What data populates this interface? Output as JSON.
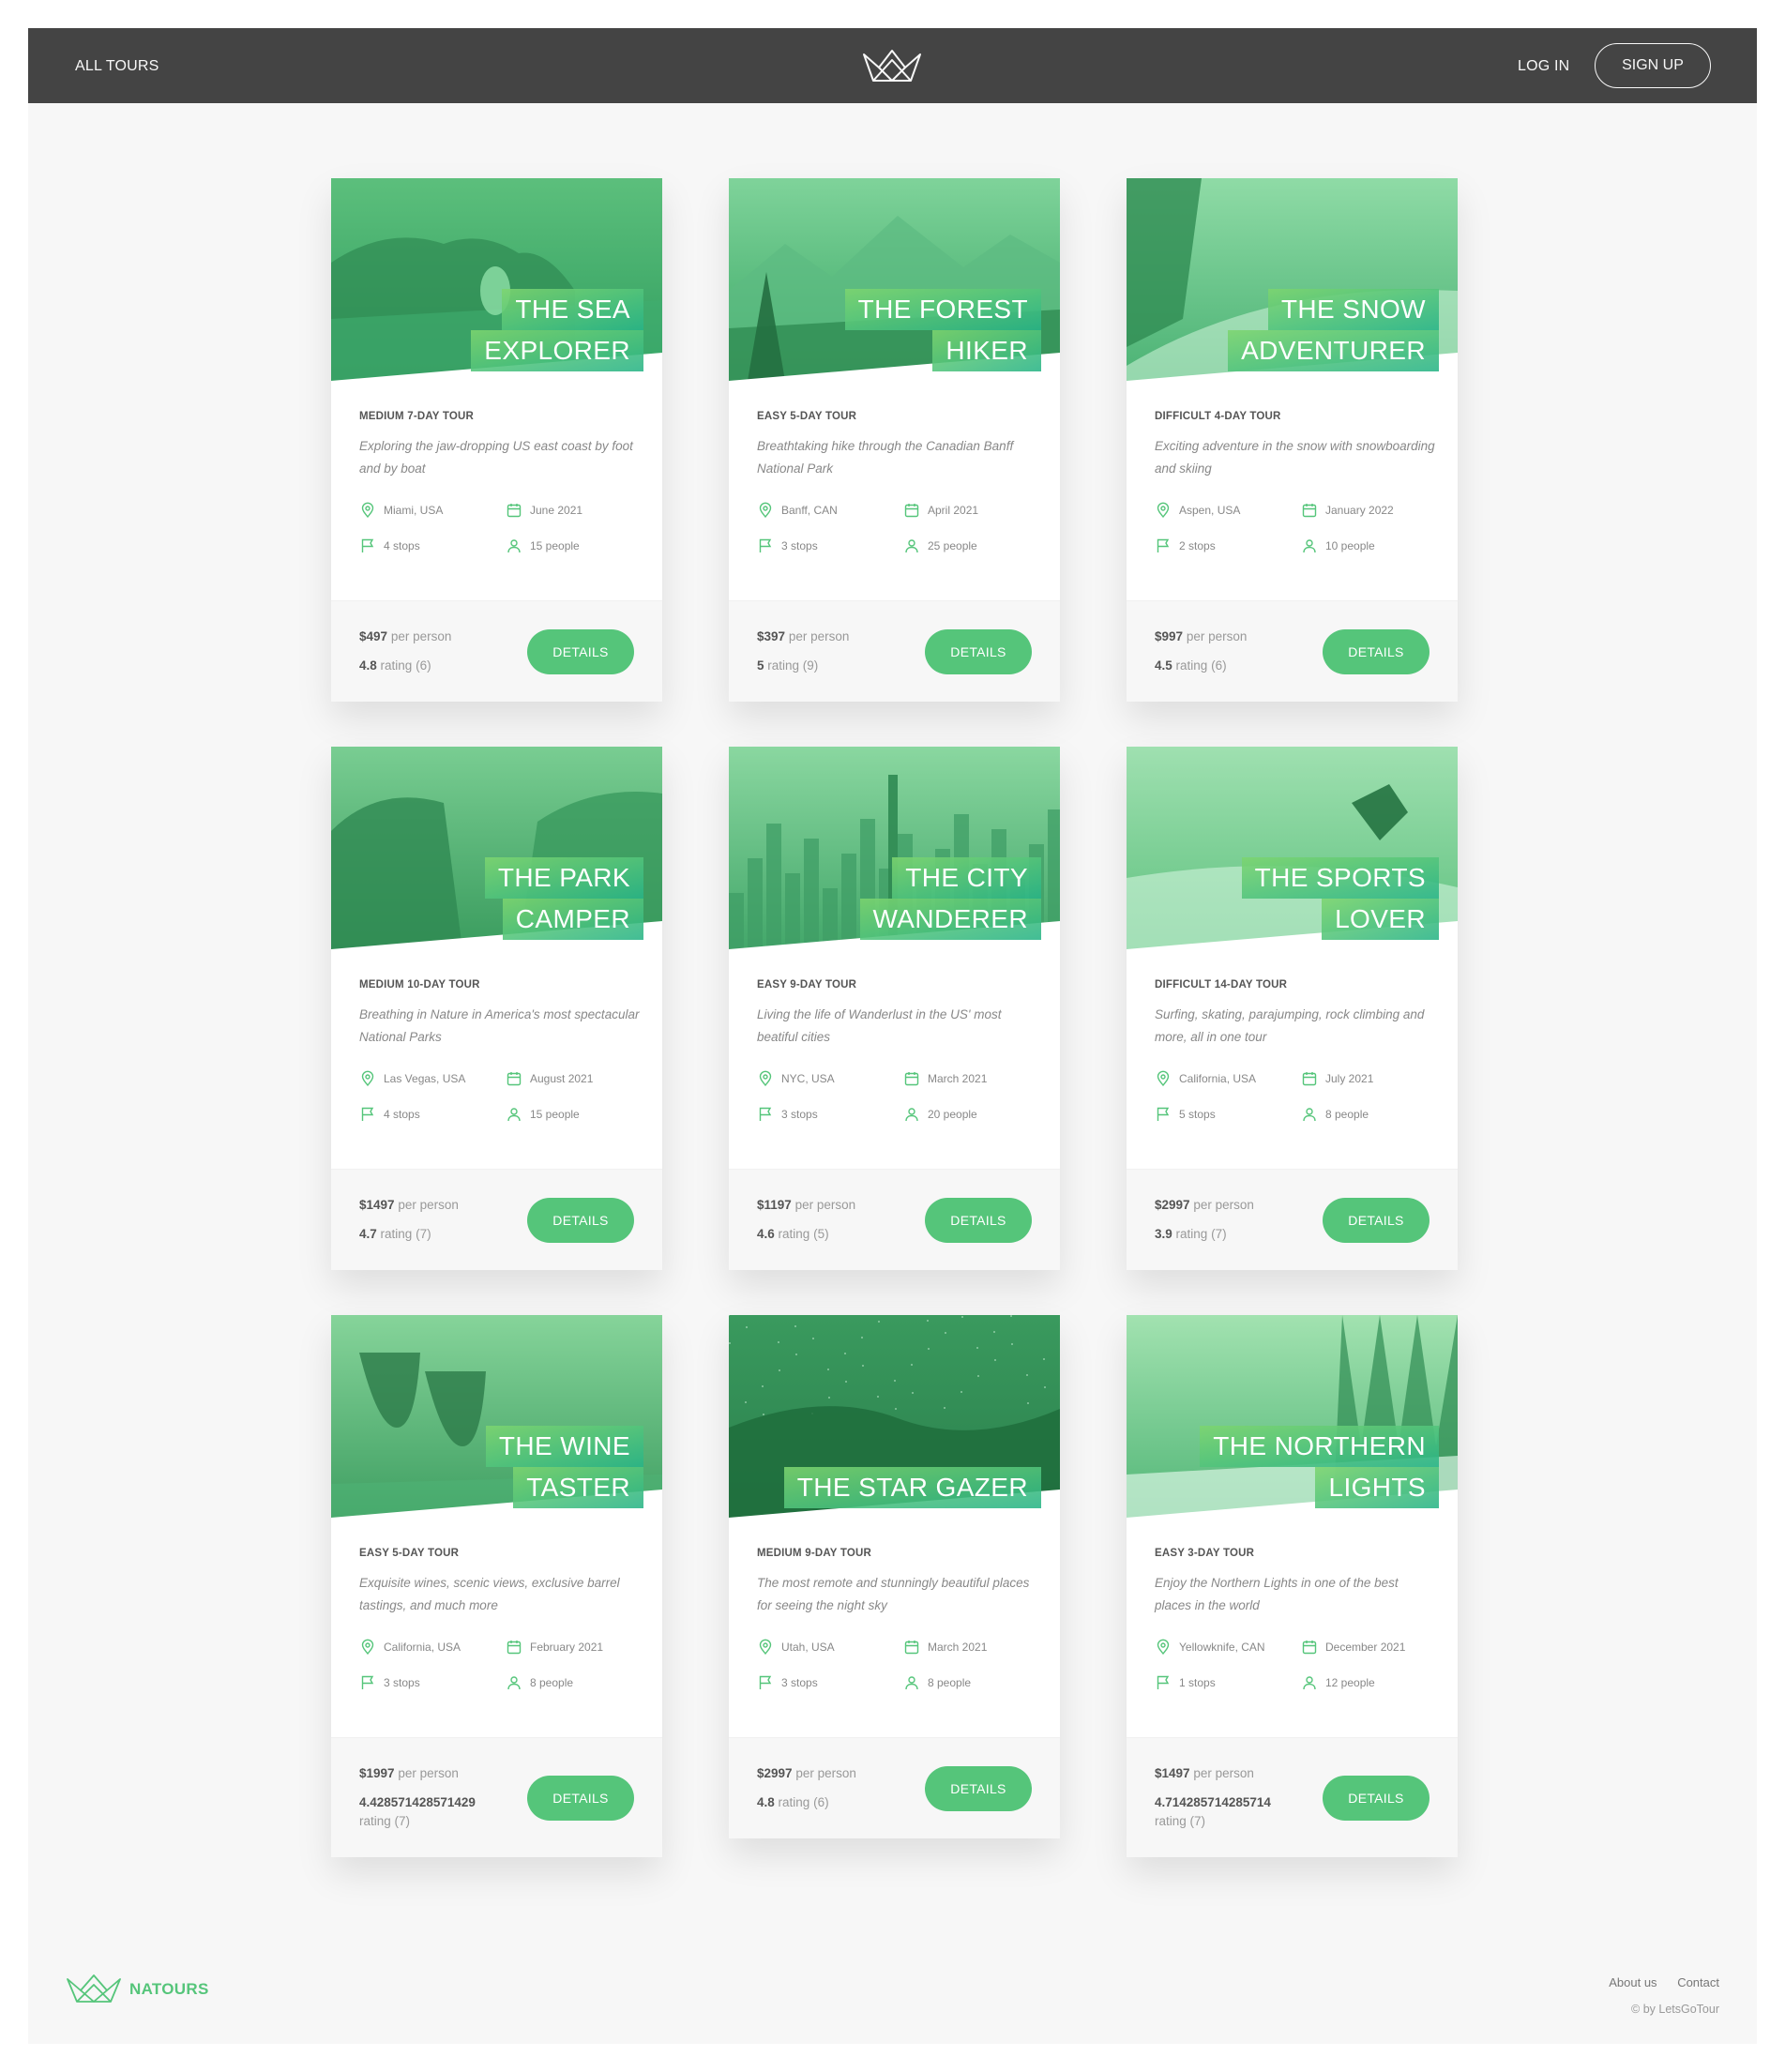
{
  "header": {
    "all_tours": "ALL TOURS",
    "log_in": "LOG IN",
    "sign_up": "SIGN UP",
    "logo_icon": "crown-logo-icon"
  },
  "colors": {
    "primary": "#55c57a",
    "header_bg": "#444444",
    "page_bg": "#f7f7f7"
  },
  "tours": [
    {
      "title_lines": [
        "THE SEA",
        "EXPLORER"
      ],
      "subheading": "MEDIUM 7-DAY TOUR",
      "summary": "Exploring the jaw-dropping US east coast by foot and by boat",
      "location": "Miami, USA",
      "date": "June 2021",
      "stops": "4 stops",
      "people": "15 people",
      "price": "$497",
      "price_suffix": "per person",
      "rating_value": "4.8",
      "rating_suffix": "rating (6)",
      "details": "DETAILS",
      "scene": "sea"
    },
    {
      "title_lines": [
        "THE FOREST",
        "HIKER"
      ],
      "subheading": "EASY 5-DAY TOUR",
      "summary": "Breathtaking hike through the Canadian Banff National Park",
      "location": "Banff, CAN",
      "date": "April 2021",
      "stops": "3 stops",
      "people": "25 people",
      "price": "$397",
      "price_suffix": "per person",
      "rating_value": "5",
      "rating_suffix": "rating (9)",
      "details": "DETAILS",
      "scene": "forest"
    },
    {
      "title_lines": [
        "THE SNOW",
        "ADVENTURER"
      ],
      "subheading": "DIFFICULT 4-DAY TOUR",
      "summary": "Exciting adventure in the snow with snowboarding and skiing",
      "location": "Aspen, USA",
      "date": "January 2022",
      "stops": "2 stops",
      "people": "10 people",
      "price": "$997",
      "price_suffix": "per person",
      "rating_value": "4.5",
      "rating_suffix": "rating (6)",
      "details": "DETAILS",
      "scene": "snow"
    },
    {
      "title_lines": [
        "THE PARK",
        "CAMPER"
      ],
      "subheading": "MEDIUM 10-DAY TOUR",
      "summary": "Breathing in Nature in America's most spectacular National Parks",
      "location": "Las Vegas, USA",
      "date": "August 2021",
      "stops": "4 stops",
      "people": "15 people",
      "price": "$1497",
      "price_suffix": "per person",
      "rating_value": "4.7",
      "rating_suffix": "rating (7)",
      "details": "DETAILS",
      "scene": "park"
    },
    {
      "title_lines": [
        "THE CITY",
        "WANDERER"
      ],
      "subheading": "EASY 9-DAY TOUR",
      "summary": "Living the life of Wanderlust in the US' most beatiful cities",
      "location": "NYC, USA",
      "date": "March 2021",
      "stops": "3 stops",
      "people": "20 people",
      "price": "$1197",
      "price_suffix": "per person",
      "rating_value": "4.6",
      "rating_suffix": "rating (5)",
      "details": "DETAILS",
      "scene": "city"
    },
    {
      "title_lines": [
        "THE SPORTS",
        "LOVER"
      ],
      "subheading": "DIFFICULT 14-DAY TOUR",
      "summary": "Surfing, skating, parajumping, rock climbing and more, all in one tour",
      "location": "California, USA",
      "date": "July 2021",
      "stops": "5 stops",
      "people": "8 people",
      "price": "$2997",
      "price_suffix": "per person",
      "rating_value": "3.9",
      "rating_suffix": "rating (7)",
      "details": "DETAILS",
      "scene": "sports"
    },
    {
      "title_lines": [
        "THE WINE",
        "TASTER"
      ],
      "subheading": "EASY 5-DAY TOUR",
      "summary": "Exquisite wines, scenic views, exclusive barrel tastings, and much more",
      "location": "California, USA",
      "date": "February 2021",
      "stops": "3 stops",
      "people": "8 people",
      "price": "$1997",
      "price_suffix": "per person",
      "rating_value": "4.428571428571429",
      "rating_suffix": "rating (7)",
      "details": "DETAILS",
      "scene": "wine"
    },
    {
      "title_lines": [
        "THE STAR GAZER"
      ],
      "subheading": "MEDIUM 9-DAY TOUR",
      "summary": "The most remote and stunningly beautiful places for seeing the night sky",
      "location": "Utah, USA",
      "date": "March 2021",
      "stops": "3 stops",
      "people": "8 people",
      "price": "$2997",
      "price_suffix": "per person",
      "rating_value": "4.8",
      "rating_suffix": "rating (6)",
      "details": "DETAILS",
      "scene": "stars"
    },
    {
      "title_lines": [
        "THE NORTHERN",
        "LIGHTS"
      ],
      "subheading": "EASY 3-DAY TOUR",
      "summary": "Enjoy the Northern Lights in one of the best places in the world",
      "location": "Yellowknife, CAN",
      "date": "December 2021",
      "stops": "1 stops",
      "people": "12 people",
      "price": "$1497",
      "price_suffix": "per person",
      "rating_value": "4.714285714285714",
      "rating_suffix": "rating (7)",
      "details": "DETAILS",
      "scene": "northern"
    }
  ],
  "icons": {
    "location": "map-pin-icon",
    "date": "calendar-icon",
    "stops": "flag-icon",
    "people": "user-icon"
  },
  "footer": {
    "brand": "NATOURS",
    "links": [
      "About us",
      "Contact"
    ],
    "copyright": "© by LetsGoTour"
  }
}
